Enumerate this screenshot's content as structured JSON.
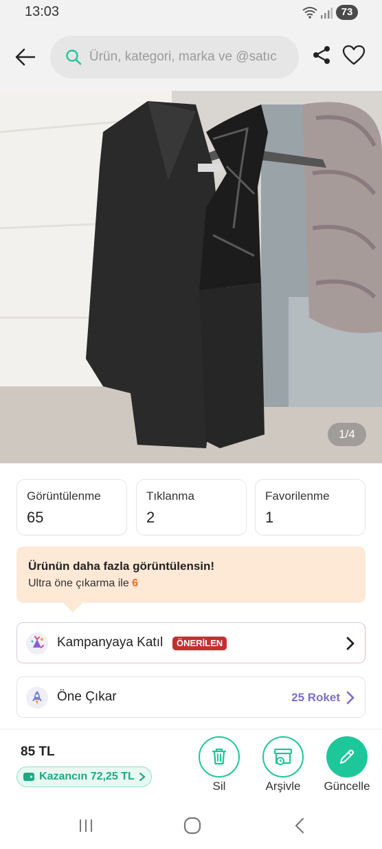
{
  "status_bar": {
    "time": "13:03",
    "battery": "73"
  },
  "header": {
    "search_placeholder": "Ürün, kategori, marka ve @satıc"
  },
  "gallery": {
    "counter": "1/4"
  },
  "stats": [
    {
      "label": "Görüntülenme",
      "value": "65"
    },
    {
      "label": "Tıklanma",
      "value": "2"
    },
    {
      "label": "Favorilenme",
      "value": "1"
    }
  ],
  "promo": {
    "title": "Ürünün daha fazla görüntülensin!",
    "subtitle": "Ultra öne çıkarma ile",
    "number": "6",
    "accent": "#f26a21"
  },
  "campaign": {
    "label": "Kampanyaya Katıl",
    "badge": "ÖNERİLEN"
  },
  "highlight": {
    "label": "Öne Çıkar",
    "cost": "25 Roket"
  },
  "bottom": {
    "price": "85 TL",
    "earnings": "Kazancın 72,25 TL",
    "actions": {
      "delete": "Sil",
      "archive": "Arşivle",
      "update": "Güncelle"
    },
    "brand_color": "#1ec79a"
  }
}
